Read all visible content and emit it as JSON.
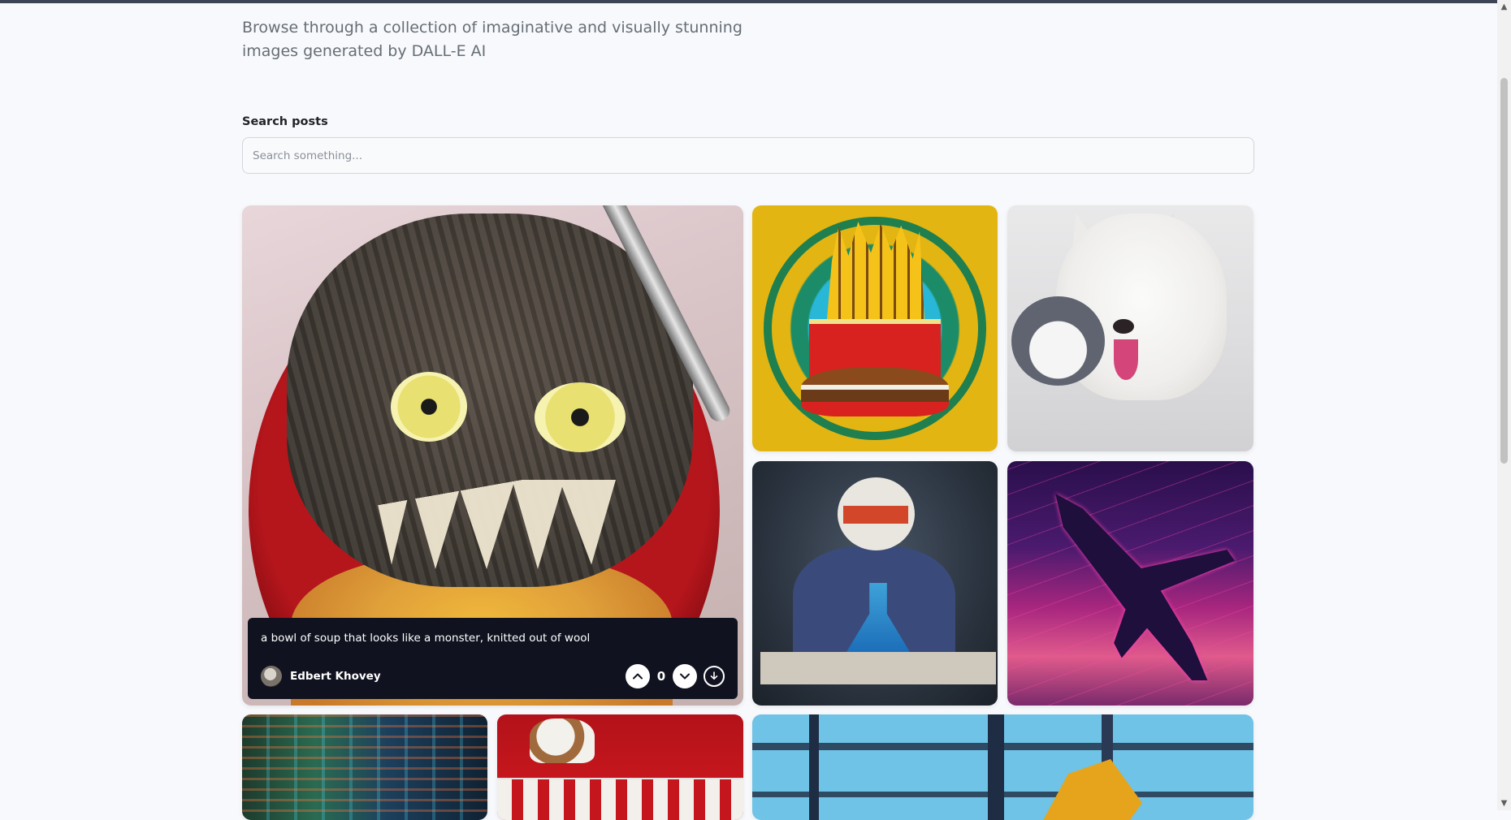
{
  "header": {
    "subtitle": "Browse through a collection of imaginative and visually stunning images generated by DALL-E AI"
  },
  "search": {
    "label": "Search posts",
    "placeholder": "Search something...",
    "value": ""
  },
  "posts": [
    {
      "prompt": "a bowl of soup that looks like a monster, knitted out of wool",
      "author": "Edbert Khovey",
      "votes": "0",
      "image": "knitted-soup-monster"
    },
    {
      "image": "stained-glass-fries-burger"
    },
    {
      "image": "white-dog-and-cat"
    },
    {
      "image": "panda-scientist"
    },
    {
      "image": "synthwave-jet"
    },
    {
      "image": "neon-city-street"
    },
    {
      "image": "cat-on-circus-tent"
    },
    {
      "image": "abstract-blue-structure"
    }
  ],
  "icons": {
    "upvote": "chevron-up-icon",
    "downvote": "chevron-down-icon",
    "download": "download-icon"
  },
  "colors": {
    "background": "#f8f9fc",
    "overlay": "#10131f",
    "text": "#222328",
    "subtext": "#666e75"
  }
}
